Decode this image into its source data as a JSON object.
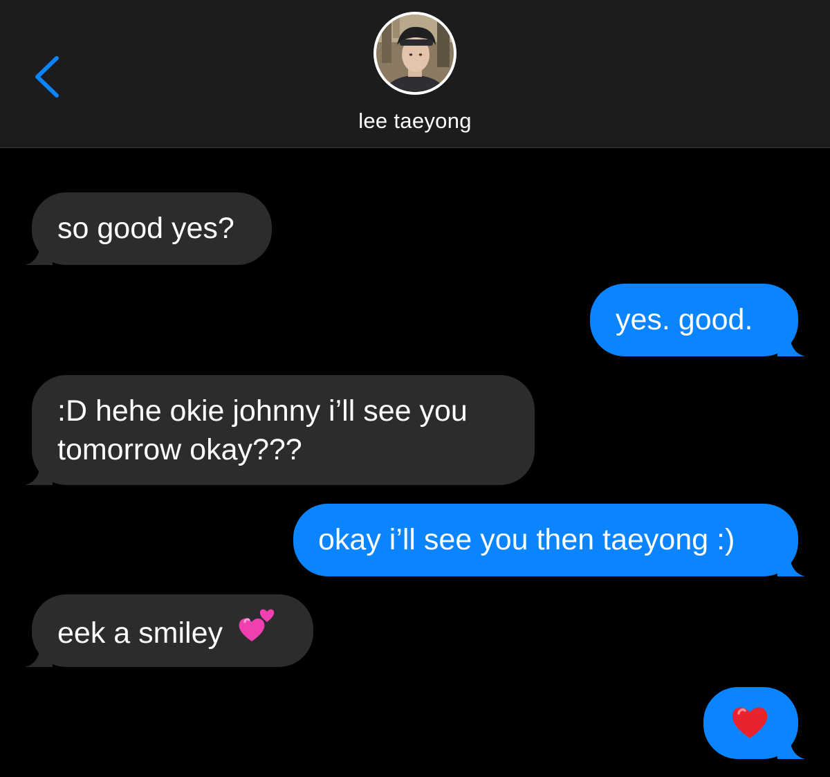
{
  "header": {
    "back_icon": "chevron-left-icon",
    "contact_name": "lee taeyong",
    "avatar_icon": "contact-photo",
    "colors": {
      "header_bg": "#1c1c1e",
      "accent": "#0a84ff"
    }
  },
  "messages": [
    {
      "direction": "incoming",
      "text": "so good yes?"
    },
    {
      "direction": "outgoing",
      "text": "yes. good."
    },
    {
      "direction": "incoming",
      "line1": ":D hehe okie johnny i’ll see you",
      "line2": "tomorrow okay???"
    },
    {
      "direction": "outgoing",
      "text": "okay i’ll see you then taeyong :)"
    },
    {
      "direction": "incoming",
      "text": "eek a smiley",
      "emoji": "two-hearts-emoji"
    },
    {
      "direction": "outgoing",
      "emoji": "red-heart-emoji"
    }
  ],
  "colors": {
    "incoming_bubble": "#2c2c2e",
    "outgoing_bubble": "#0a84ff",
    "background": "#000000"
  }
}
